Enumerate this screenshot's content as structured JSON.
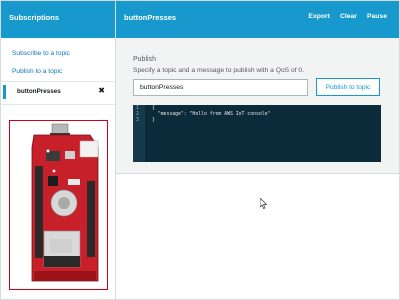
{
  "sidebar": {
    "header_title": "Subscriptions",
    "links": [
      "Subscribe to a topic",
      "Publish to a topic"
    ],
    "active_topic": "buttonPresses",
    "close_glyph": "✖"
  },
  "header": {
    "title": "buttonPresses",
    "actions": [
      "Export",
      "Clear",
      "Pause"
    ]
  },
  "publish": {
    "title": "Publish",
    "description": "Specify a topic and a message to publish with a QoS of 0.",
    "topic_value": "buttonPresses",
    "button_label": "Publish to topic",
    "editor_lines": [
      {
        "num": "1",
        "text": "{"
      },
      {
        "num": "2",
        "text": "  \"message\": \"Hello from AWS IoT console\""
      },
      {
        "num": "3",
        "text": "}"
      }
    ]
  },
  "colors": {
    "header": "#1899cd",
    "editor_bg": "#0c2b3a",
    "device_frame": "#d0021b"
  }
}
